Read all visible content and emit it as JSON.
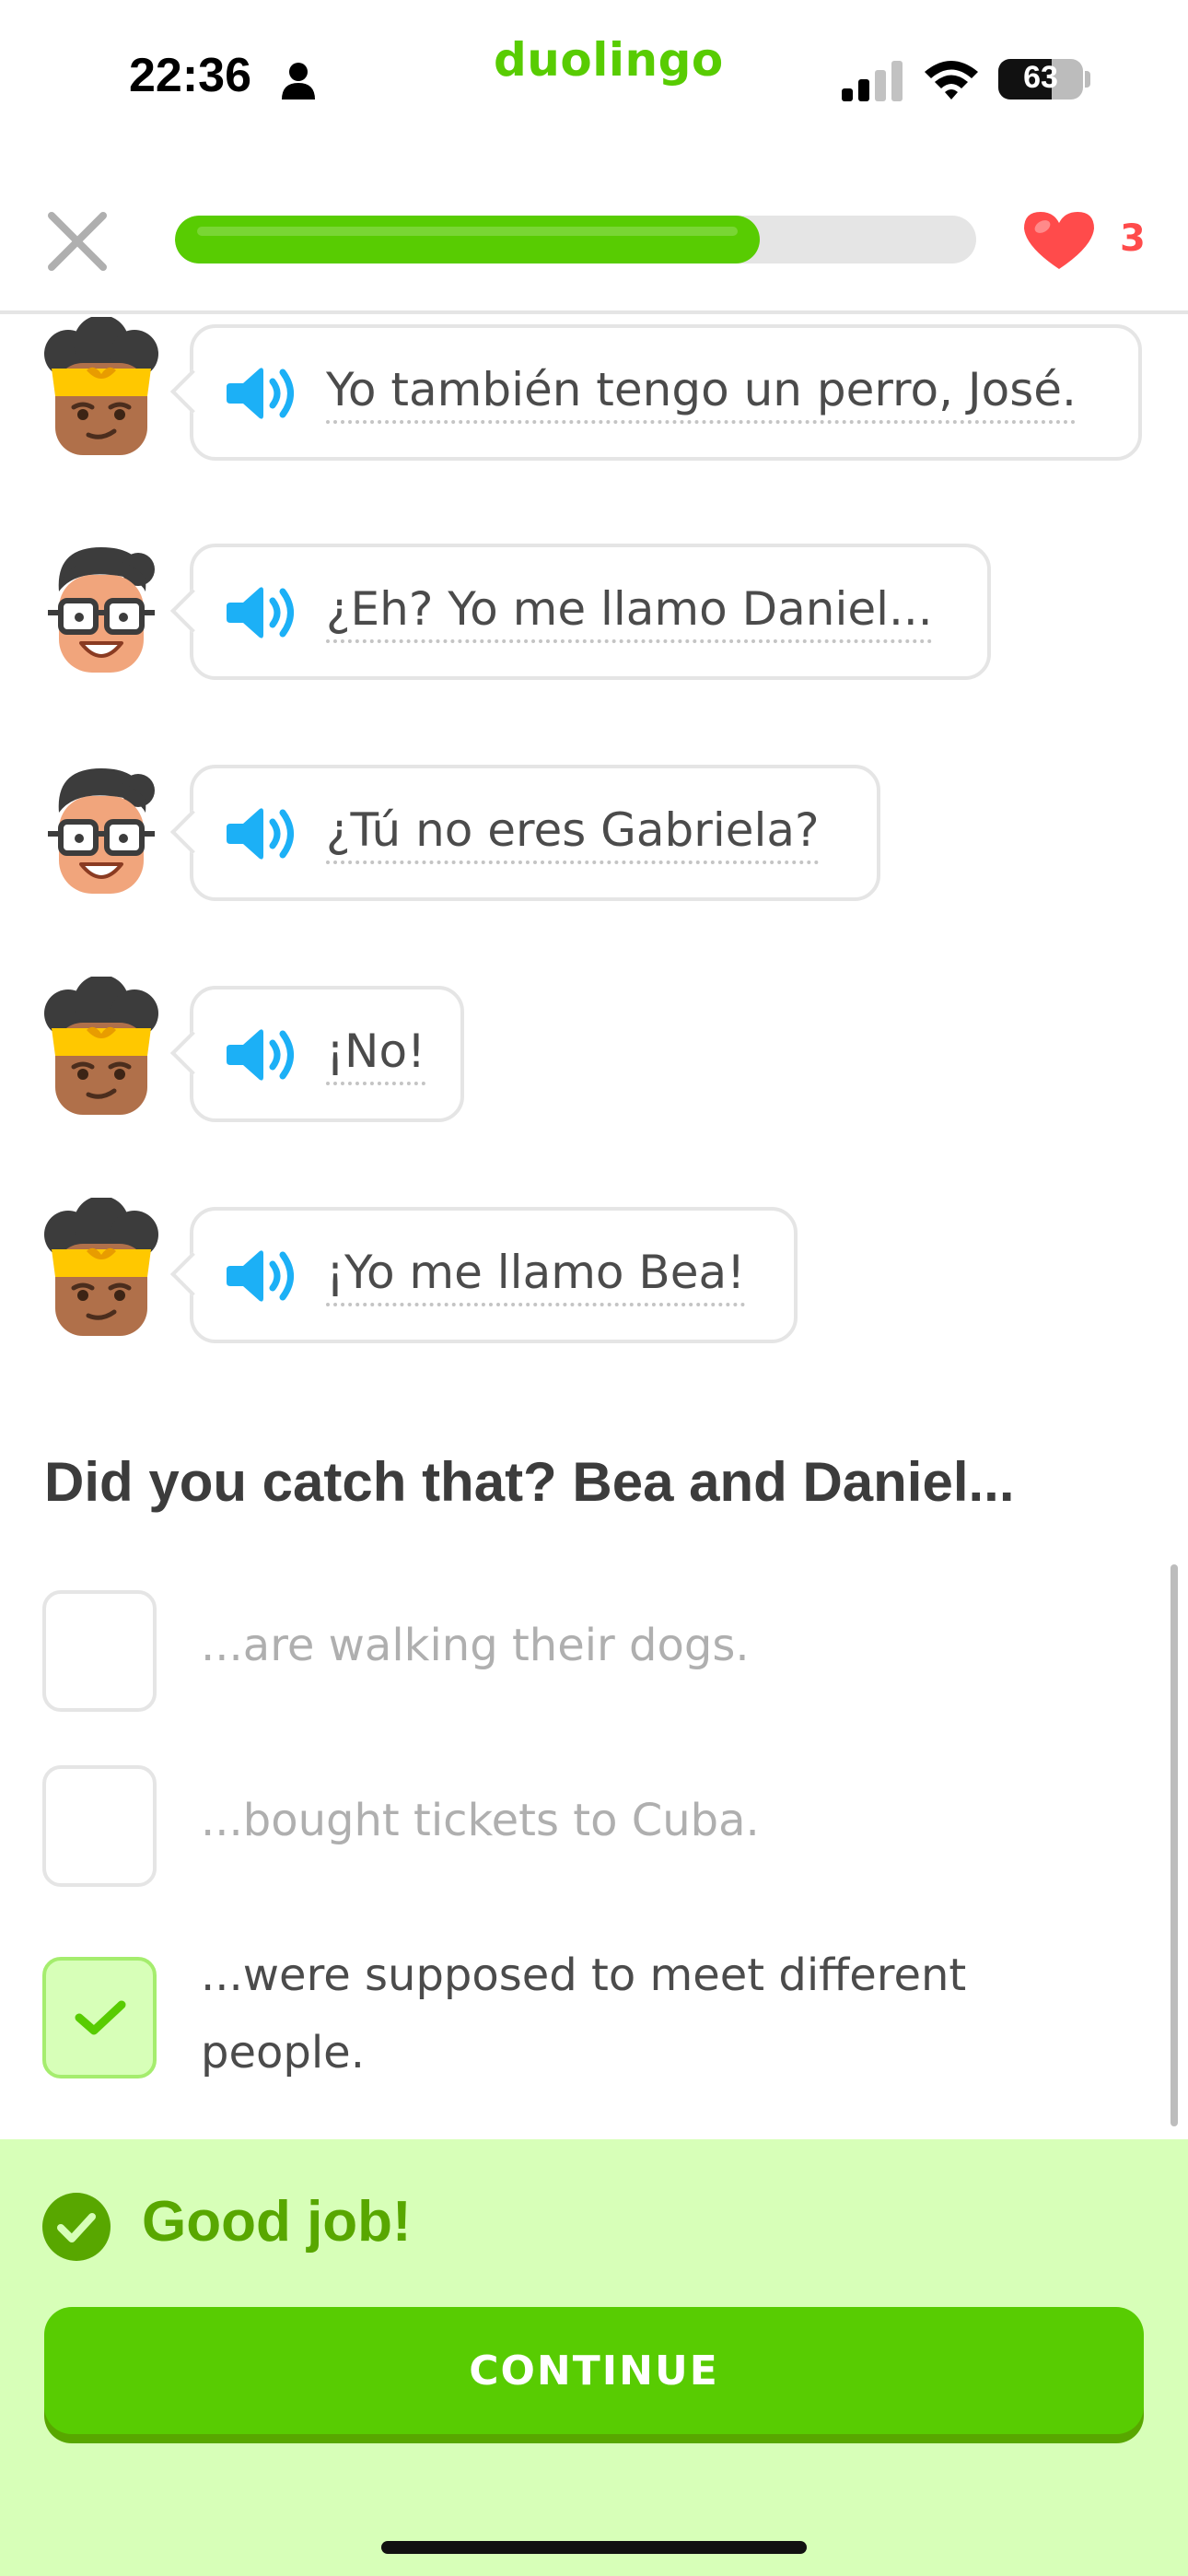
{
  "status_bar": {
    "time": "22:36",
    "battery": "63",
    "battery_level": 0.63,
    "icons": [
      "person-icon",
      "cellular-signal-icon",
      "wifi-icon",
      "battery-icon"
    ]
  },
  "app": {
    "brand": "duolingo"
  },
  "header": {
    "close_icon": "close-icon",
    "progress": 0.73,
    "hearts": "3",
    "heart_icon": "heart-icon"
  },
  "dialogue": [
    {
      "speaker": "bea",
      "text": "Yo también tengo un perro, José."
    },
    {
      "speaker": "daniel",
      "text": "¿Eh? Yo me llamo Daniel..."
    },
    {
      "speaker": "daniel",
      "text": "¿Tú no eres Gabriela?"
    },
    {
      "speaker": "bea",
      "text": "¡No!"
    },
    {
      "speaker": "bea",
      "text": "¡Yo me llamo Bea!"
    }
  ],
  "question": "Did you catch that? Bea and Daniel...",
  "options": [
    {
      "text": "...are walking their dogs.",
      "checked": false
    },
    {
      "text": "...bought tickets to Cuba.",
      "checked": false
    },
    {
      "text": "...were supposed to meet different people.",
      "checked": true
    }
  ],
  "feedback": {
    "message": "Good job!",
    "continue_label": "CONTINUE"
  },
  "colors": {
    "brand_green": "#58cc02",
    "dark_green": "#58a700",
    "feedback_bg": "#d7ffb8",
    "heart_red": "#ff4b4b",
    "speaker_blue": "#1cb0f6"
  }
}
